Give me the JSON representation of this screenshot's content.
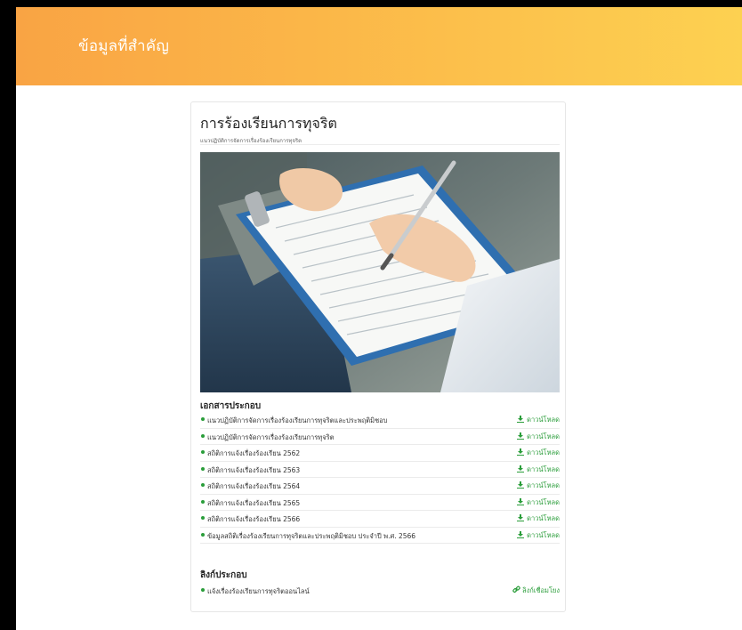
{
  "banner": {
    "title": "ข้อมูลที่สำคัญ"
  },
  "card": {
    "title": "การร้องเรียนการทุจริต",
    "subtitle": "แนวปฏิบัติการจัดการเรื่องร้องเรียนการทุจริต",
    "image_alt_icon": "clipboard-writing-photo"
  },
  "documents": {
    "heading": "เอกสารประกอบ",
    "download_label": "ดาวน์โหลด",
    "download_icon": "download-icon",
    "items": [
      {
        "label": "แนวปฏิบัติการจัดการเรื่องร้องเรียนการทุจริตและประพฤติมิชอบ"
      },
      {
        "label": "แนวปฏิบัติการจัดการเรื่องร้องเรียนการทุจริต"
      },
      {
        "label": "สถิติการแจ้งเรื่องร้องเรียน 2562"
      },
      {
        "label": "สถิติการแจ้งเรื่องร้องเรียน 2563"
      },
      {
        "label": "สถิติการแจ้งเรื่องร้องเรียน 2564"
      },
      {
        "label": "สถิติการแจ้งเรื่องร้องเรียน 2565"
      },
      {
        "label": "สถิติการแจ้งเรื่องร้องเรียน 2566"
      },
      {
        "label": "ข้อมูลสถิติเรื่องร้องเรียนการทุจริตและประพฤติมิชอบ ประจำปี พ.ศ. 2566"
      }
    ]
  },
  "links": {
    "heading": "ลิงก์ประกอบ",
    "link_label": "ลิงก์เชื่อมโยง",
    "link_icon": "chain-link-icon",
    "items": [
      {
        "label": "แจ้งเรื่องร้องเรียนการทุจริตออนไลน์"
      }
    ]
  },
  "colors": {
    "banner_start": "#f9a444",
    "banner_end": "#fdd151",
    "accent_green": "#2a9d3a"
  }
}
